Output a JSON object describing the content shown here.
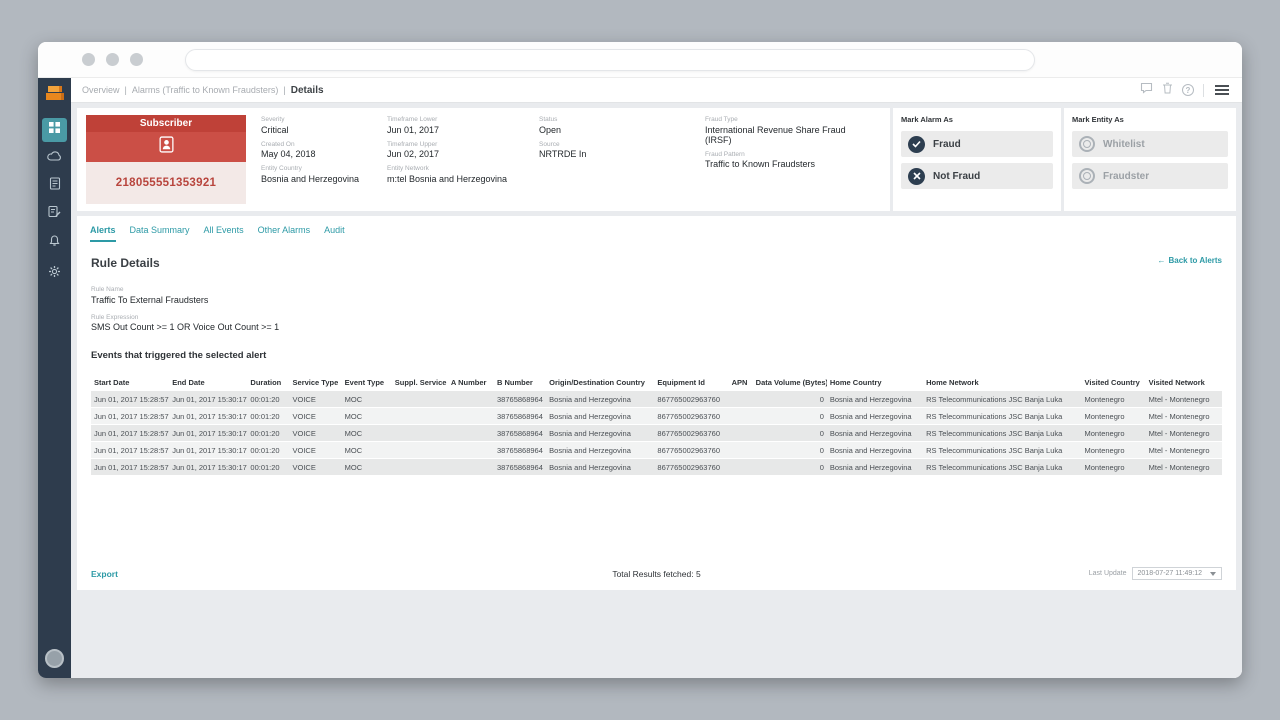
{
  "colors": {
    "accent_teal": "#2D9AA6",
    "brand_orange": "#E8871E",
    "alert_red": "#BF4138",
    "sidebar_navy": "#2E3C4D",
    "icon_navy": "#2D3E50"
  },
  "browser": {
    "url_value": ""
  },
  "header": {
    "breadcrumb": [
      "Overview",
      "Alarms (Traffic to Known Fraudsters)",
      "Details"
    ],
    "separator": "|"
  },
  "sidebar": {
    "items": [
      "dashboard",
      "cloud",
      "reports",
      "rules",
      "alarms",
      "settings"
    ]
  },
  "subscriber_card": {
    "title": "Subscriber",
    "number": "218055551353921"
  },
  "alarm_details": {
    "columns": [
      {
        "fields": [
          {
            "label": "Severity",
            "value": "Critical"
          },
          {
            "label": "Created On",
            "value": "May 04, 2018"
          },
          {
            "label": "Entity Country",
            "value": "Bosnia and Herzegovina"
          }
        ]
      },
      {
        "fields": [
          {
            "label": "Timeframe Lower",
            "value": "Jun 01, 2017"
          },
          {
            "label": "Timeframe Upper",
            "value": "Jun 02, 2017"
          },
          {
            "label": "Entity Network",
            "value": "m:tel Bosnia and Herzegovina"
          }
        ]
      },
      {
        "fields": [
          {
            "label": "Status",
            "value": "Open"
          },
          {
            "label": "Source",
            "value": "NRTRDE In"
          }
        ]
      },
      {
        "fields": [
          {
            "label": "Fraud Type",
            "value": "International Revenue Share Fraud (IRSF)"
          },
          {
            "label": "Fraud Pattern",
            "value": "Traffic to Known Fraudsters"
          }
        ]
      }
    ]
  },
  "mark_alarm": {
    "title": "Mark Alarm As",
    "buttons": [
      {
        "label": "Fraud"
      },
      {
        "label": "Not Fraud"
      }
    ]
  },
  "mark_entity": {
    "title": "Mark Entity As",
    "buttons": [
      {
        "label": "Whitelist"
      },
      {
        "label": "Fraudster"
      }
    ]
  },
  "tabs": [
    {
      "label": "Alerts"
    },
    {
      "label": "Data Summary"
    },
    {
      "label": "All Events"
    },
    {
      "label": "Other Alarms"
    },
    {
      "label": "Audit"
    }
  ],
  "rule_details": {
    "heading": "Rule Details",
    "back_arrow": "←",
    "back_link": "Back to Alerts",
    "rule_name_label": "Rule Name",
    "rule_name": "Traffic To External Fraudsters",
    "rule_expression_label": "Rule Expression",
    "rule_expression": "SMS Out Count >= 1 OR Voice Out Count >= 1",
    "events_heading": "Events that triggered the selected alert"
  },
  "events_table": {
    "columns": [
      "Start Date",
      "End Date",
      "Duration",
      "Service Type",
      "Event Type",
      "Suppl. Service",
      "A Number",
      "B Number",
      "Origin/Destination Country",
      "Equipment Id",
      "APN",
      "Data Volume (Bytes)",
      "Home Country",
      "Home Network",
      "Visited Country",
      "Visited Network"
    ],
    "rows": [
      [
        "Jun 01, 2017 15:28:57",
        "Jun 01, 2017 15:30:17",
        "00:01:20",
        "VOICE",
        "MOC",
        "",
        "",
        "38765868964",
        "Bosnia and Herzegovina",
        "867765002963760",
        "",
        "0",
        "Bosnia and Herzegovina",
        "RS Telecommunications JSC Banja Luka",
        "Montenegro",
        "Mtel - Montenegro"
      ],
      [
        "Jun 01, 2017 15:28:57",
        "Jun 01, 2017 15:30:17",
        "00:01:20",
        "VOICE",
        "MOC",
        "",
        "",
        "38765868964",
        "Bosnia and Herzegovina",
        "867765002963760",
        "",
        "0",
        "Bosnia and Herzegovina",
        "RS Telecommunications JSC Banja Luka",
        "Montenegro",
        "Mtel - Montenegro"
      ],
      [
        "Jun 01, 2017 15:28:57",
        "Jun 01, 2017 15:30:17",
        "00:01:20",
        "VOICE",
        "MOC",
        "",
        "",
        "38765868964",
        "Bosnia and Herzegovina",
        "867765002963760",
        "",
        "0",
        "Bosnia and Herzegovina",
        "RS Telecommunications JSC Banja Luka",
        "Montenegro",
        "Mtel - Montenegro"
      ],
      [
        "Jun 01, 2017 15:28:57",
        "Jun 01, 2017 15:30:17",
        "00:01:20",
        "VOICE",
        "MOC",
        "",
        "",
        "38765868964",
        "Bosnia and Herzegovina",
        "867765002963760",
        "",
        "0",
        "Bosnia and Herzegovina",
        "RS Telecommunications JSC Banja Luka",
        "Montenegro",
        "Mtel - Montenegro"
      ],
      [
        "Jun 01, 2017 15:28:57",
        "Jun 01, 2017 15:30:17",
        "00:01:20",
        "VOICE",
        "MOC",
        "",
        "",
        "38765868964",
        "Bosnia and Herzegovina",
        "867765002963760",
        "",
        "0",
        "Bosnia and Herzegovina",
        "RS Telecommunications JSC Banja Luka",
        "Montenegro",
        "Mtel - Montenegro"
      ]
    ]
  },
  "footer": {
    "export_label": "Export",
    "total_results": "Total Results fetched: 5",
    "last_update_label": "Last Update",
    "last_update_value": "2018-07-27 11:49:12"
  }
}
